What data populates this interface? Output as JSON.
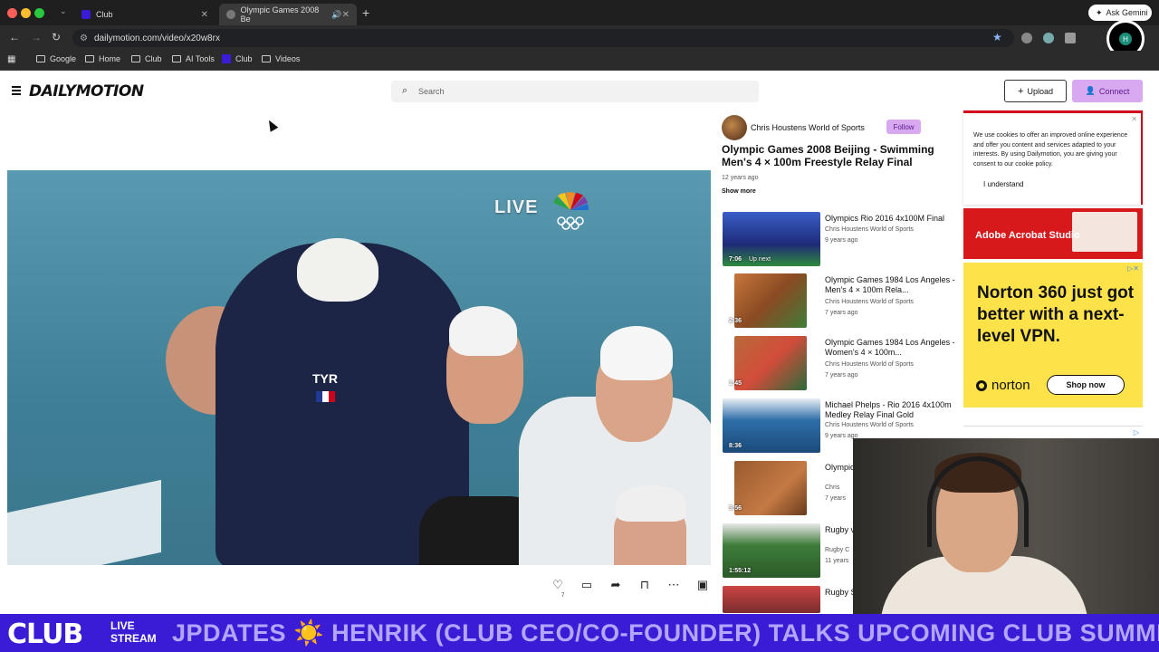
{
  "browser": {
    "tabs": [
      {
        "title": "Club"
      },
      {
        "title": "Olympic Games 2008 Be"
      }
    ],
    "url": "dailymotion.com/video/x20w8rx",
    "gemini_label": "Ask Gemini",
    "profile_initial": "H",
    "bookmarks": [
      "Google",
      "Home",
      "Club",
      "AI Tools",
      "Club",
      "Videos"
    ]
  },
  "site": {
    "logo": "DAILYMOTION",
    "search_placeholder": "Search",
    "upload_label": "Upload",
    "connect_label": "Connect"
  },
  "video": {
    "overlay_live": "LIVE",
    "suit_brand": "TYR",
    "like_count": "7"
  },
  "channel": {
    "name": "Chris Houstens World of Sports",
    "follow_label": "Follow"
  },
  "current_video": {
    "title": "Olympic Games 2008 Beijing - Swimming Men's 4 × 100m Freestyle Relay Final",
    "age": "12 years ago",
    "show_more": "Show more"
  },
  "related": [
    {
      "title": "Olympics Rio 2016 4x100M Final",
      "channel": "Chris Houstens World of Sports",
      "age": "9 years ago",
      "duration": "7:06",
      "badge": "Up next",
      "thumb_color": "#2c3fa8"
    },
    {
      "title": "Olympic Games 1984 Los Angeles - Men's 4 × 100m Rela...",
      "channel": "Chris Houstens World of Sports",
      "age": "7 years ago",
      "duration": "2:36",
      "badge": "",
      "thumb_color": "#a8602f"
    },
    {
      "title": "Olympic Games 1984 Los Angeles - Women's 4 × 100m...",
      "channel": "Chris Houstens World of Sports",
      "age": "7 years ago",
      "duration": "1:45",
      "badge": "",
      "thumb_color": "#9a6a3a"
    },
    {
      "title": "Michael Phelps - Rio 2016 4x100m Medley Relay Final Gold",
      "channel": "Chris Houstens World of Sports",
      "age": "9 years ago",
      "duration": "8:36",
      "badge": "",
      "thumb_color": "#2d6fa8"
    },
    {
      "title": "Olympic Angele",
      "channel": "Chris",
      "age": "7 years",
      "duration": "5:56",
      "badge": "",
      "thumb_color": "#8a4e2a"
    },
    {
      "title": "Rugby vs New",
      "channel": "Rugby C",
      "age": "11 years",
      "duration": "1:55:12",
      "badge": "",
      "thumb_color": "#3f7d3a"
    },
    {
      "title": "Rugby South A",
      "channel": "",
      "age": "",
      "duration": "",
      "badge": "",
      "thumb_color": "#7a2c2c"
    }
  ],
  "cookie": {
    "text": "We use cookies to offer an improved online experience and offer you content and services adapted to your interests. By using Dailymotion, you are giving your consent to our cookie policy.",
    "button": "I understand"
  },
  "ads": {
    "adobe": "Adobe Acrobat Studio",
    "norton_headline": "Norton 360 just got better with a next-level VPN.",
    "norton_brand": "norton",
    "norton_cta": "Shop now"
  },
  "banner": {
    "brand": "CLUB",
    "live_line1": "LIVE",
    "live_line2": "STREAM",
    "ticker": "JPDATES ☀️ HENRIK (CLUB CEO/CO-FOUNDER) TALKS UPCOMING CLUB SUMMER"
  },
  "colors": {
    "accent_purple": "#d8a8f0",
    "club_blue": "#3b1cd6",
    "norton_yellow": "#fde24a",
    "adobe_red": "#d7191c"
  }
}
